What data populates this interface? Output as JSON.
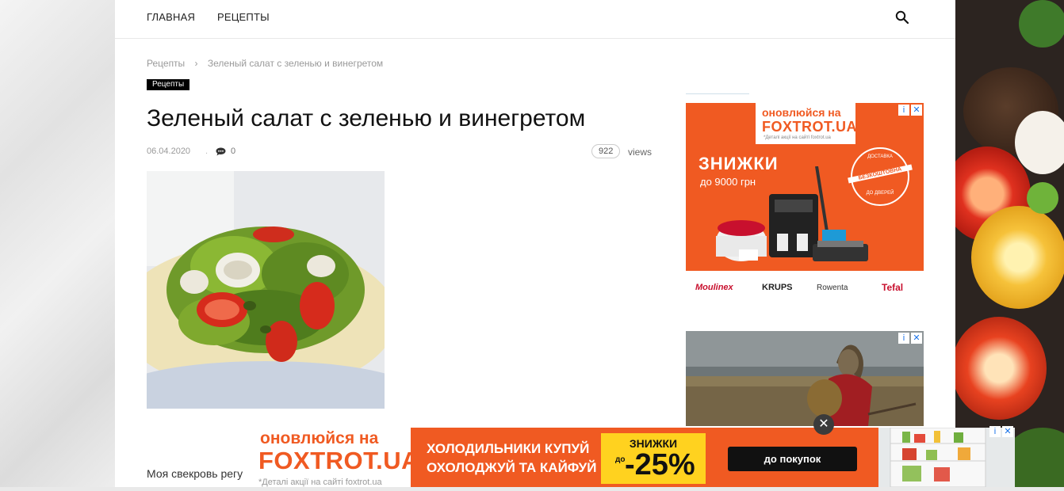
{
  "nav": {
    "home": "ГЛАВНАЯ",
    "recipes": "РЕЦЕПТЫ"
  },
  "breadcrumb": {
    "root": "Рецепты",
    "sep": "›",
    "current": "Зеленый салат с зеленью и винегретом"
  },
  "category_badge": "Рецепты",
  "post": {
    "title": "Зеленый салат с зеленью и винегретом",
    "date": "06.04.2020",
    "comments": "0",
    "views_count": "922",
    "views_label": "views",
    "body_start": "Моя свекровь регу"
  },
  "ad1": {
    "headline1": "оновлюйся на",
    "headline2": "FOXTROT.UA",
    "fine_print": "*Деталі акції на сайті foxtrot.ua",
    "promo1": "ЗНИЖКИ",
    "promo2": "до 9000 грн",
    "stamp_top": "ДОСТАВКА",
    "stamp_mid": "БЕЗКОШТОВНА",
    "stamp_bottom": "ДО ДВЕРЕЙ",
    "brands": [
      "Moulinex",
      "KRUPS",
      "Rowenta",
      "Tefal"
    ]
  },
  "ad_controls": {
    "info": "i",
    "close": "✕"
  },
  "bottom_ad": {
    "headline1": "оновлюйся на",
    "headline2": "FOXTROT.UA",
    "fine_print": "*Деталі акції на сайті foxtrot.ua",
    "line1": "ХОЛОДИЛЬНИКИ КУПУЙ",
    "line2": "ОХОЛОДЖУЙ ТА КАЙФУЙ",
    "discount_title": "ЗНИЖКИ",
    "discount_prefix": "до",
    "discount_value": "-25%",
    "cta": "до покупок"
  },
  "close_btn": "✕",
  "colors": {
    "accent_orange": "#f05a22",
    "badge_bg": "#000000",
    "promo_yellow": "#ffd21f"
  }
}
